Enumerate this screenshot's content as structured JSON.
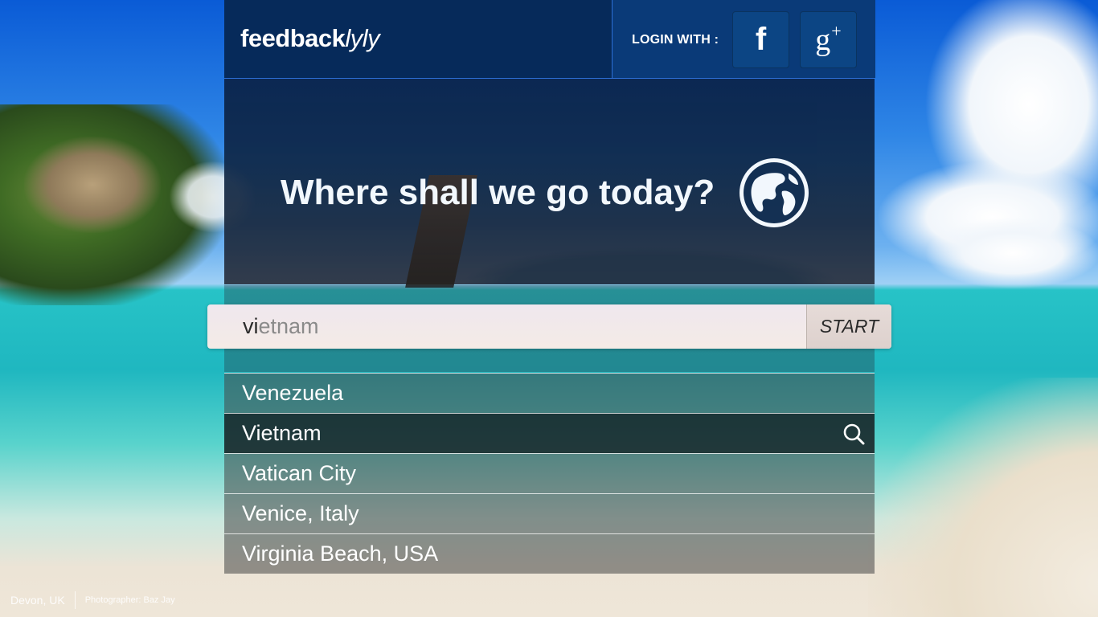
{
  "brand": {
    "name_bold": "feedback",
    "name_thin": "lyly"
  },
  "login": {
    "label": "LOGIN WITH :",
    "facebook_glyph": "f",
    "google_glyph": "g",
    "google_plus": "+"
  },
  "hero": {
    "headline": "Where shall we go today?",
    "icon": "globe-icon"
  },
  "search": {
    "value": "vietnam",
    "typed": "vi",
    "rest": "etnam",
    "button_label": "START"
  },
  "suggestions": [
    {
      "label": "Venezuela"
    },
    {
      "label": "Vietnam",
      "active": true,
      "icon": "search-icon"
    },
    {
      "label": "Vatican City"
    },
    {
      "label": "Venice, Italy"
    },
    {
      "label": "Virginia Beach, USA"
    }
  ],
  "credit": {
    "place": "Devon, UK",
    "photographer": "Photographer: Baz Jay"
  }
}
